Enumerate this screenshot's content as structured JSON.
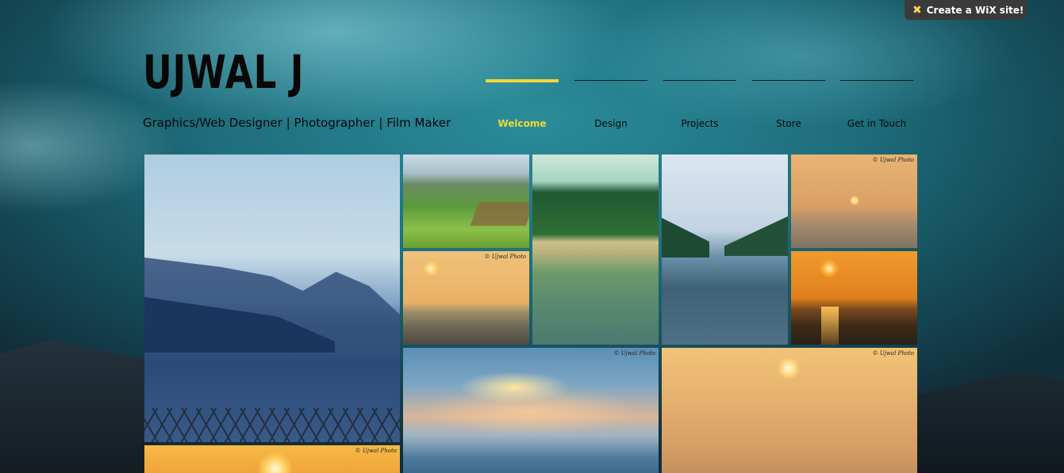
{
  "banner": {
    "label": "Create a WiX  site!",
    "icon": "wix-star-icon"
  },
  "site": {
    "name": "UJWAL J",
    "tagline": "Graphics/Web Designer | Photographer | Film Maker"
  },
  "nav": {
    "items": [
      {
        "label": "Welcome",
        "active": true
      },
      {
        "label": "Design",
        "active": false
      },
      {
        "label": "Projects",
        "active": false
      },
      {
        "label": "Store",
        "active": false
      },
      {
        "label": "Get in Touch",
        "active": false
      }
    ],
    "active_color": "#f2d932"
  },
  "gallery": {
    "watermark": "© Ujwal Photo",
    "photos": [
      "misty-lake-mountains",
      "tea-plantation-hills",
      "beach-sunset-fishermen",
      "forest-island-lake",
      "valley-lake-reflection",
      "sea-sunset-haze",
      "golden-sunset-waves",
      "sunrays-over-sea",
      "orange-sunset-sky",
      "bright-sun-horizon"
    ]
  }
}
